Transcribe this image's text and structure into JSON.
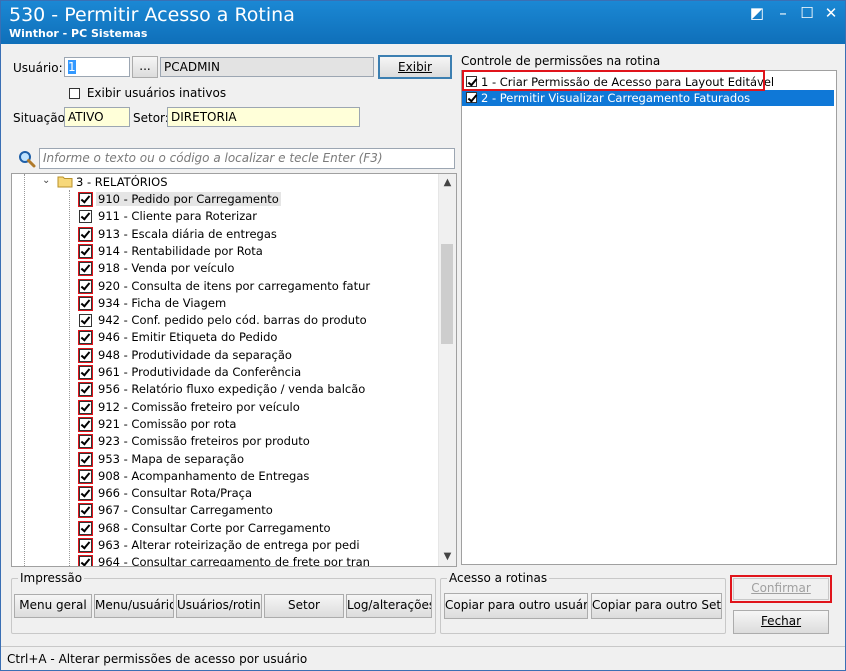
{
  "window": {
    "title": "530 - Permitir Acesso a Rotina",
    "subtitle": "Winthor - PC Sistemas",
    "controls": [
      "◩",
      "–",
      "☐",
      "✕"
    ]
  },
  "user": {
    "label": "Usuário:",
    "code": "1",
    "lookup_label": "...",
    "name": "PCADMIN",
    "show_button": "Exibir",
    "inactive_checkbox_label": "Exibir usuários inativos",
    "inactive_checked": false,
    "situation_label": "Situação:",
    "situation_value": "ATIVO",
    "sector_label": "Setor:",
    "sector_value": "DIRETORIA"
  },
  "search": {
    "placeholder": "Informe o texto ou o código a localizar e tecle Enter (F3)"
  },
  "tree": {
    "folder_label": "3 - RELATÓRIOS",
    "items": [
      {
        "label": "910 - Pedido por Carregamento",
        "checked": true,
        "red": true,
        "selected": true
      },
      {
        "label": "911 - Cliente para Roterizar",
        "checked": true,
        "red": false
      },
      {
        "label": "913 - Escala diária de entregas",
        "checked": true,
        "red": true
      },
      {
        "label": "914 - Rentabilidade por Rota",
        "checked": true,
        "red": true
      },
      {
        "label": "918 - Venda por veículo",
        "checked": true,
        "red": true
      },
      {
        "label": "920 - Consulta de itens por carregamento fatur",
        "checked": true,
        "red": true
      },
      {
        "label": "934 - Ficha de Viagem",
        "checked": true,
        "red": true
      },
      {
        "label": "942 - Conf. pedido pelo cód. barras do produto",
        "checked": true,
        "red": false
      },
      {
        "label": "946 - Emitir Etiqueta do Pedido",
        "checked": true,
        "red": true
      },
      {
        "label": "948 - Produtividade da separação",
        "checked": true,
        "red": true
      },
      {
        "label": "961 - Produtividade da Conferência",
        "checked": true,
        "red": true
      },
      {
        "label": "956 - Relatório fluxo expedição / venda balcão",
        "checked": true,
        "red": true
      },
      {
        "label": "912 - Comissão freteiro por veículo",
        "checked": true,
        "red": true
      },
      {
        "label": "921 - Comissão por rota",
        "checked": true,
        "red": true
      },
      {
        "label": "923 - Comissão freteiros por produto",
        "checked": true,
        "red": true
      },
      {
        "label": "953 - Mapa de separação",
        "checked": true,
        "red": true
      },
      {
        "label": "908 - Acompanhamento de Entregas",
        "checked": true,
        "red": true
      },
      {
        "label": "966 - Consultar Rota/Praça",
        "checked": true,
        "red": true
      },
      {
        "label": "967 - Consultar Carregamento",
        "checked": true,
        "red": true
      },
      {
        "label": "968 - Consultar Corte por Carregamento",
        "checked": true,
        "red": true
      },
      {
        "label": "963 - Alterar roteirização de entrega por pedi",
        "checked": true,
        "red": true
      },
      {
        "label": "964 - Consultar carregamento de frete por tran",
        "checked": true,
        "red": true
      }
    ]
  },
  "permissions": {
    "title": "Controle de permissões na rotina",
    "items": [
      {
        "label": "1 - Criar Permissão de Acesso para Layout Editável",
        "checked": true,
        "selected": false
      },
      {
        "label": "2 - Permitir Visualizar Carregamento Faturados",
        "checked": true,
        "selected": true
      }
    ]
  },
  "impressao": {
    "title": "Impressão",
    "buttons": [
      "Menu geral",
      "Menu/usuário",
      "Usuários/rotina",
      "Setor",
      "Log/alterações"
    ]
  },
  "acesso": {
    "title": "Acesso a rotinas",
    "copy_user": "Copiar para outro usuário",
    "copy_sector": "Copiar para outro Setor"
  },
  "actions": {
    "confirm": "Confirmar",
    "close": "Fechar"
  },
  "status": {
    "text": "Ctrl+A - Alterar permissões de acesso por usuário"
  },
  "colors": {
    "titlebar": "#1580cc",
    "selection": "#0f78d7",
    "highlight_red": "#e0141b",
    "field_yellow": "#ffffd9"
  }
}
